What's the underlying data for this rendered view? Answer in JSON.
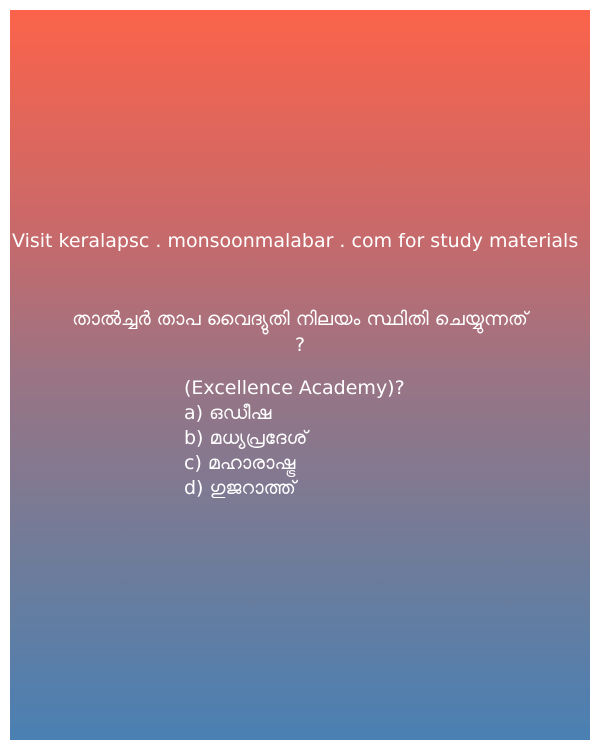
{
  "promo_text": "Visit keralapsc . monsoonmalabar . com for study materials",
  "question": {
    "line1": "താൽച്ചർ താപ വൈദ്യുതി നിലയം സ്ഥിതി ചെയ്യുന്നത്",
    "line2": "?"
  },
  "source": "(Excellence Academy)?",
  "options": [
    "a) ഒഡീഷ",
    "b) മധ്യപ്രദേശ്",
    "c) മഹാരാഷ്ട്ര",
    "d) ഗുജറാത്ത്"
  ]
}
